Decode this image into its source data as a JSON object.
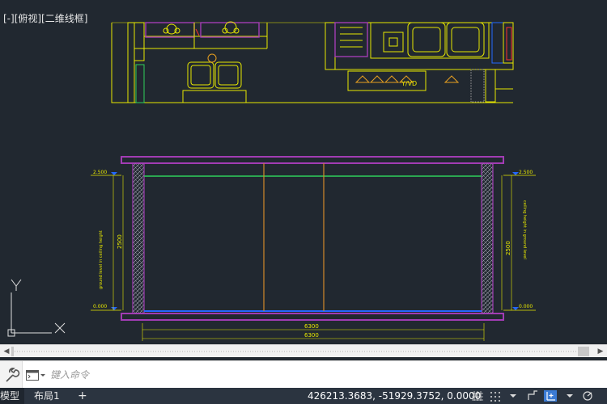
{
  "viewport": {
    "label": "[-][俯视][二维线框]"
  },
  "ucs": {
    "y_label": "Y",
    "x_label": "X"
  },
  "elevation": {
    "left_top_level": "2.500",
    "left_bottom_level": "0.000",
    "right_top_level": "2.500",
    "right_bottom_level": "0.000",
    "left_height_dim": "2500",
    "left_height_dim2": "2500",
    "right_height_dim": "2500",
    "right_height_dim2": "2500",
    "bottom_dim_1": "6300",
    "bottom_dim_2": "6300",
    "left_note": "ground level in ceiling height",
    "right_note": "ceiling height in ground level"
  },
  "plan": {
    "sign_text": "Y/VD"
  },
  "command": {
    "placeholder": "键入命令"
  },
  "status": {
    "tabs": [
      "模型",
      "布局1"
    ],
    "add_tab": "+",
    "coordinates": "426213.3683, -51929.3752, 0.0000"
  },
  "colors": {
    "canvas": "#212830",
    "purple": "#a23cb4",
    "yellow": "#e8e800",
    "green": "#2fcf5a",
    "blue": "#2468ff",
    "orange": "#d28a2a",
    "status_bg": "#2b3440"
  }
}
